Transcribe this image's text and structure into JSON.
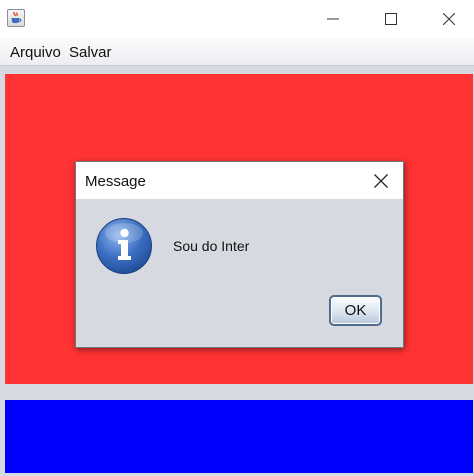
{
  "window": {
    "title": "",
    "app_icon": "java-icon",
    "controls": [
      "minimize-icon",
      "maximize-icon",
      "close-icon"
    ]
  },
  "menubar": {
    "items": [
      {
        "label": "Arquivo"
      },
      {
        "label": "Salvar"
      }
    ]
  },
  "panels": {
    "top_color": "#ff3333",
    "bottom_color": "#0000ff"
  },
  "dialog": {
    "title": "Message",
    "icon": "info-icon",
    "message": "Sou do Inter",
    "ok_label": "OK"
  }
}
